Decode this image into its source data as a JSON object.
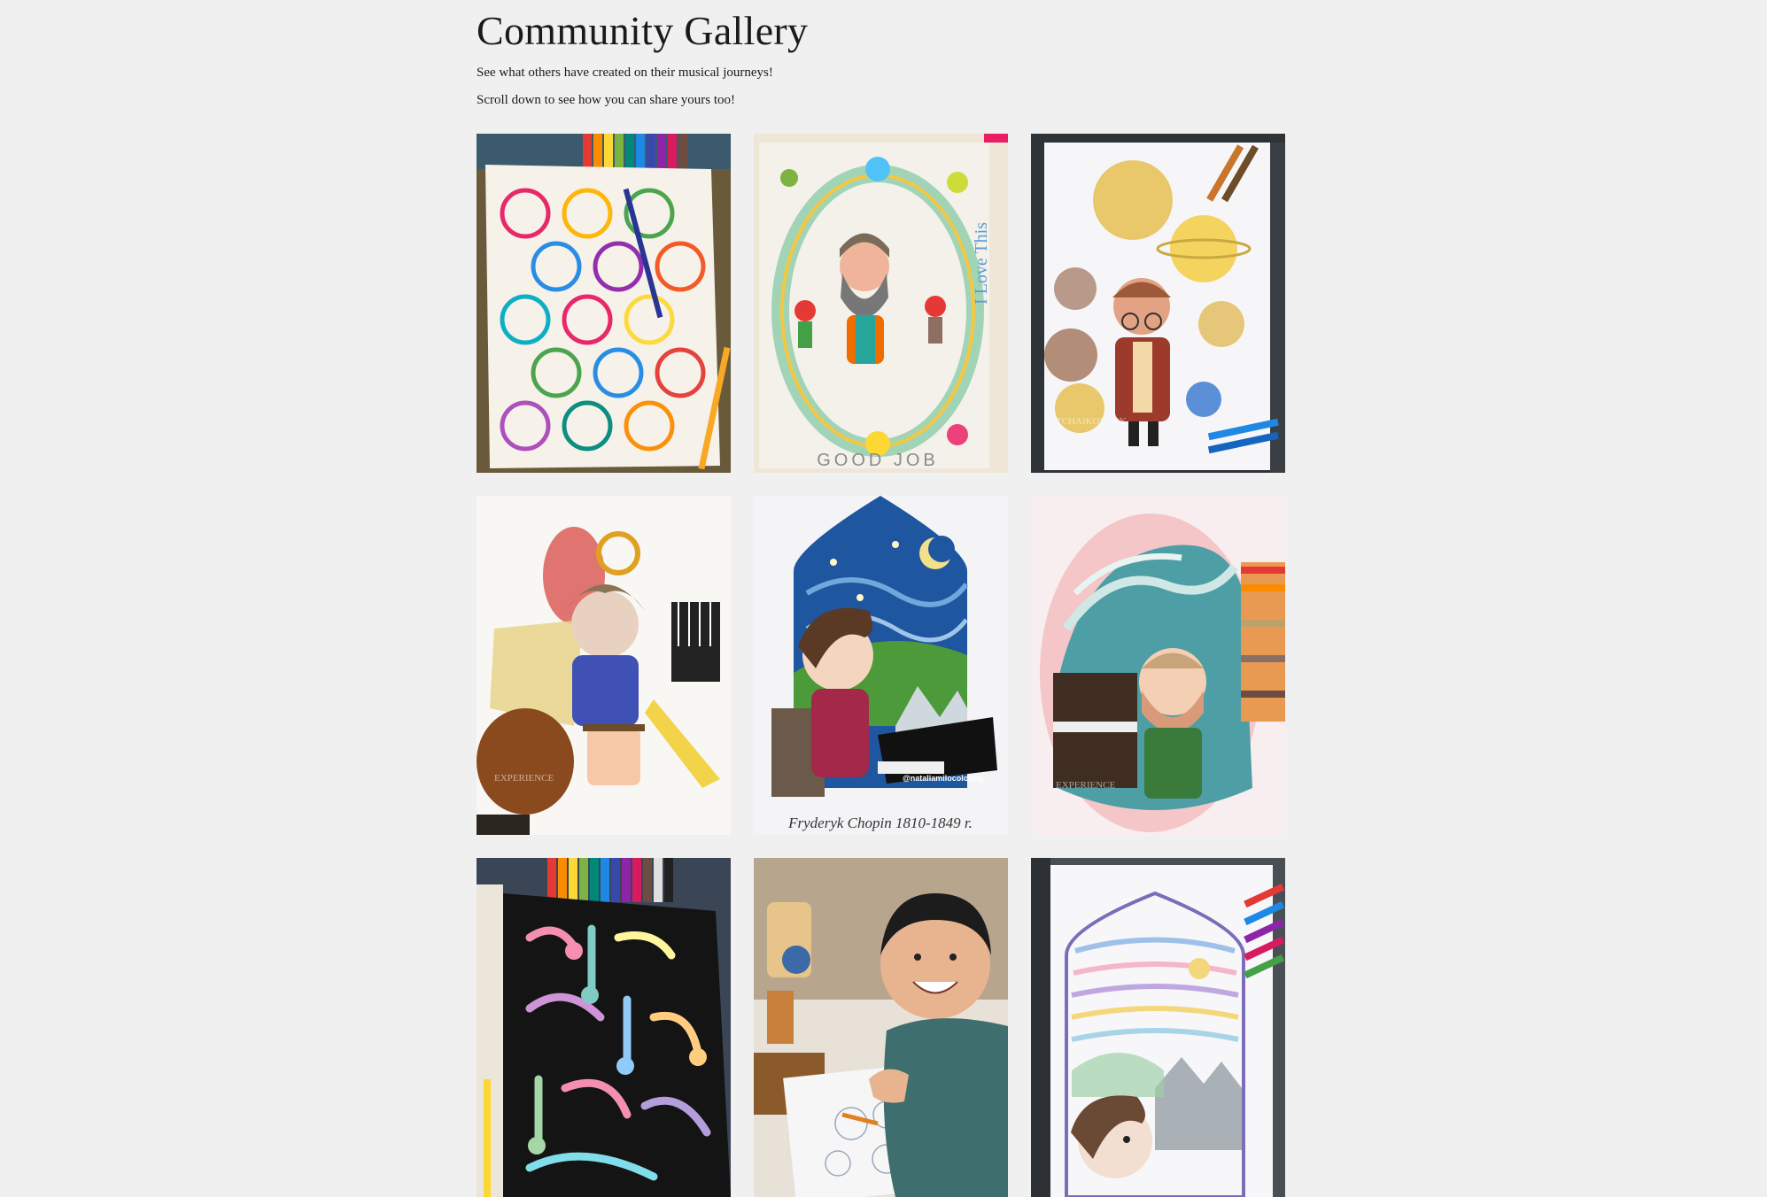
{
  "header": {
    "title": "Community Gallery",
    "subtitle1": "See what others have created on their musical journeys!",
    "subtitle2": "Scroll down to see how you can share yours too!"
  },
  "gallery": {
    "items": [
      {
        "name": "music-pattern-coloring",
        "icon": "music-pattern-image"
      },
      {
        "name": "tchaikovsky-nutcracker-coloring",
        "icon": "composer-portrait-image",
        "handwriting": "I Love This",
        "bottom_text": "GOOD JOB"
      },
      {
        "name": "holst-planets-coloring",
        "icon": "composer-planets-image"
      },
      {
        "name": "beethoven-instruments-coloring",
        "icon": "composer-instruments-image"
      },
      {
        "name": "chopin-starry-night-coloring",
        "icon": "composer-starry-night-image",
        "tag": "@nataliamilocoloring",
        "caption": "Fryderyk Chopin 1810-1849 r."
      },
      {
        "name": "debussy-wave-coloring",
        "icon": "composer-wave-image"
      },
      {
        "name": "music-notes-coloring",
        "icon": "music-notes-image"
      },
      {
        "name": "child-coloring-photo",
        "icon": "child-photo-image"
      },
      {
        "name": "chopin-stained-glass-coloring",
        "icon": "composer-stained-glass-image"
      }
    ]
  },
  "colors": {
    "background": "#f0f0f0",
    "text": "#1a1a1a"
  }
}
